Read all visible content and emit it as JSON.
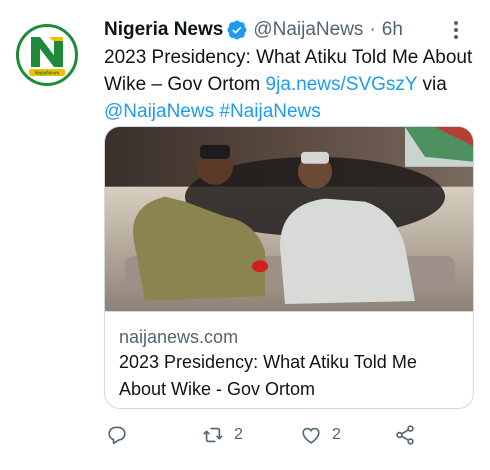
{
  "tweet": {
    "display_name": "Nigeria News",
    "handle": "@NaijaNews",
    "separator": "·",
    "time": "6h",
    "text_main": "2023 Presidency: What Atiku Told Me About Wike – Gov Ortom ",
    "text_link": "9ja.news/SVGszY",
    "text_via": " via ",
    "text_mention": "@NaijaNews",
    "text_space": " ",
    "text_hashtag": "#NaijaNews"
  },
  "avatar": {
    "logo_text": "NaijaNews",
    "brand_color": "#1e8a3a"
  },
  "card": {
    "domain": "naijanews.com",
    "title": "2023 Presidency: What Atiku Told Me About Wike - Gov Ortom"
  },
  "actions": {
    "reply_icon": "reply-icon",
    "retweet_icon": "retweet-icon",
    "retweet_count": "2",
    "like_icon": "heart-icon",
    "like_count": "2",
    "share_icon": "share-icon"
  },
  "colors": {
    "link": "#1d9bf0",
    "muted": "#536471",
    "text": "#0f1419",
    "verified": "#1d9bf0"
  }
}
